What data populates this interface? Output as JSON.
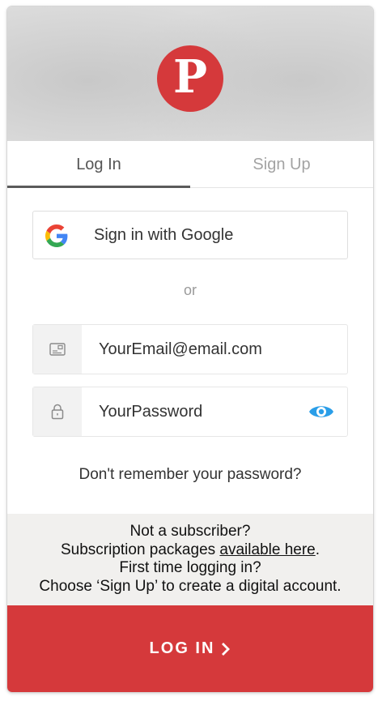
{
  "brand": {
    "logo_letter": "P",
    "accent_color": "#d5393b",
    "link_color": "#2a9ee8"
  },
  "tabs": [
    {
      "label": "Log In",
      "active": true
    },
    {
      "label": "Sign Up",
      "active": false
    }
  ],
  "google": {
    "label": "Sign in with Google",
    "icon": "google-g-icon"
  },
  "divider_text": "or",
  "email": {
    "value": "YourEmail@email.com",
    "icon": "envelope-icon"
  },
  "password": {
    "value": "YourPassword",
    "icon": "lock-icon",
    "toggle_icon": "eye-icon"
  },
  "forgot_password": "Don't remember your password?",
  "info": {
    "line1": "Not a subscriber?",
    "line2_prefix": "Subscription packages ",
    "line2_link": "available here",
    "line2_suffix": ".",
    "line3": "First time logging in?",
    "line4": "Choose ‘Sign Up’ to create a digital account."
  },
  "submit": {
    "label": "LOG IN"
  }
}
